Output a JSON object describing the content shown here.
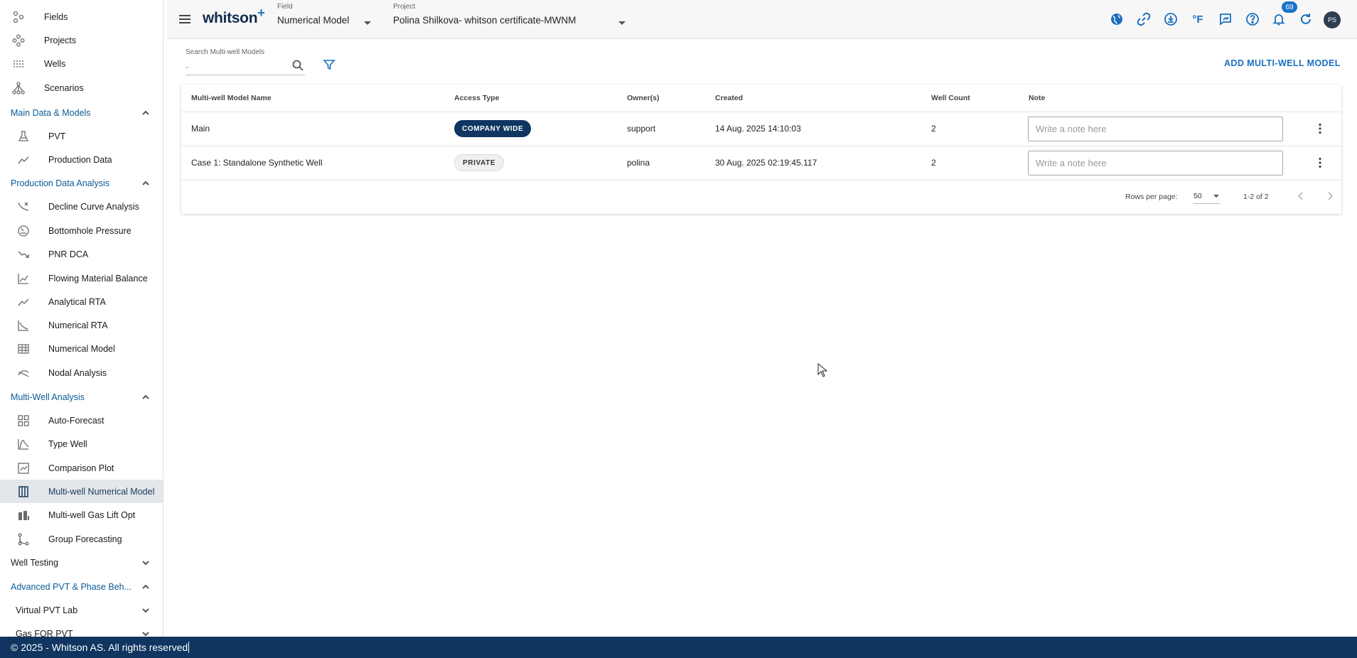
{
  "sidebar": {
    "top_items": [
      {
        "label": "Fields",
        "icon": "fields-icon"
      },
      {
        "label": "Projects",
        "icon": "projects-icon"
      },
      {
        "label": "Wells",
        "icon": "wells-icon"
      },
      {
        "label": "Scenarios",
        "icon": "scenarios-icon"
      }
    ],
    "sections": {
      "main_data": {
        "label": "Main Data & Models",
        "expanded": true,
        "items": [
          {
            "label": "PVT",
            "icon": "flask-icon"
          },
          {
            "label": "Production Data",
            "icon": "trend-line-icon"
          }
        ]
      },
      "production_analysis": {
        "label": "Production Data Analysis",
        "expanded": true,
        "items": [
          {
            "label": "Decline Curve Analysis",
            "icon": "decline-curve-icon"
          },
          {
            "label": "Bottomhole Pressure",
            "icon": "gauge-icon"
          },
          {
            "label": "PNR DCA",
            "icon": "trend-down-icon"
          },
          {
            "label": "Flowing Material Balance",
            "icon": "chart-axes-icon"
          },
          {
            "label": "Analytical RTA",
            "icon": "trend-line-icon"
          },
          {
            "label": "Numerical RTA",
            "icon": "decline-axes-icon"
          },
          {
            "label": "Numerical Model",
            "icon": "grid-model-icon"
          },
          {
            "label": "Nodal Analysis",
            "icon": "nodal-icon"
          }
        ]
      },
      "multi_well": {
        "label": "Multi-Well Analysis",
        "expanded": true,
        "items": [
          {
            "label": "Auto-Forecast",
            "icon": "grid-icon"
          },
          {
            "label": "Type Well",
            "icon": "type-curve-icon"
          },
          {
            "label": "Comparison Plot",
            "icon": "compare-icon"
          },
          {
            "label": "Multi-well Numerical Model",
            "icon": "columns-icon",
            "active": true
          },
          {
            "label": "Multi-well Gas Lift Opt",
            "icon": "gas-lift-icon"
          },
          {
            "label": "Group Forecasting",
            "icon": "group-icon"
          }
        ]
      },
      "well_testing": {
        "label": "Well Testing",
        "expanded": false
      },
      "advanced_pvt": {
        "label": "Advanced PVT & Phase Beh...",
        "expanded": true,
        "subsections": [
          {
            "label": "Virtual PVT Lab"
          },
          {
            "label": "Gas FOR PVT"
          }
        ]
      }
    }
  },
  "topbar": {
    "logo": "whitson",
    "logo_plus": "+",
    "field_caption": "Field",
    "field_value": "Numerical Model",
    "project_caption": "Project",
    "project_value": "Polina Shilkova- whitson certificate-MWNM",
    "temp_unit": "°F",
    "notifications_count": "69",
    "avatar_initials": "PS"
  },
  "toolbar": {
    "search_label": "Search Multi-well Models",
    "search_placeholder": "-",
    "add_button": "ADD MULTI-WELL MODEL"
  },
  "table": {
    "columns": [
      "Multi-well Model Name",
      "Access Type",
      "Owner(s)",
      "Created",
      "Well Count",
      "Note"
    ],
    "rows": [
      {
        "name": "Main",
        "access": "COMPANY WIDE",
        "owner": "support",
        "created": "14 Aug. 2025 14:10:03",
        "well_count": "2",
        "note_placeholder": "Write a note here"
      },
      {
        "name": "Case 1: Standalone Synthetic Well",
        "access": "PRIVATE",
        "owner": "polina",
        "created": "30 Aug. 2025 02:19:45.117",
        "well_count": "2",
        "note_placeholder": "Write a note here"
      }
    ],
    "pagination": {
      "rows_per_page_label": "Rows per page:",
      "rows_per_page": "50",
      "range": "1-2 of 2"
    }
  },
  "statusbar": {
    "text": "© 2025 - Whitson AS. All rights reserved"
  },
  "colors": {
    "brand_dark": "#0f3560",
    "accent_blue": "#1a73c8",
    "section_blue": "#0a5a96",
    "active_bg": "#e3e6ea"
  }
}
